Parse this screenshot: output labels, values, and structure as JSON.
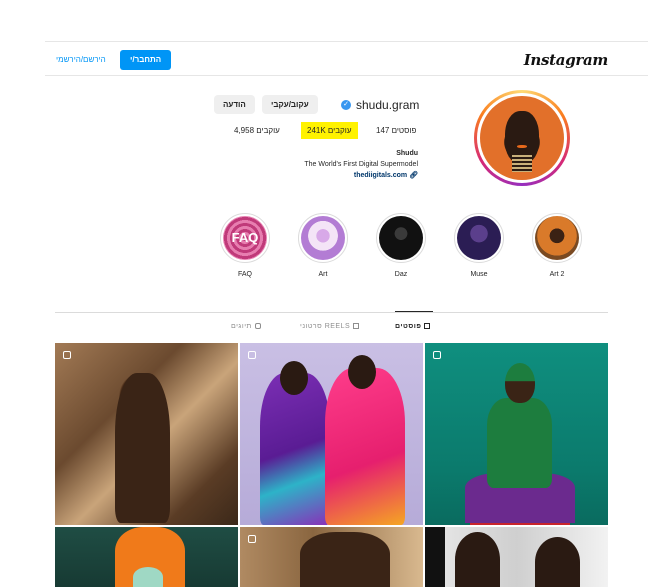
{
  "header": {
    "logo": "Instagram",
    "login_label": "התחבר/י",
    "signup_label": "הירשם/הירשמי"
  },
  "profile": {
    "username": "shudu.gram",
    "verified": true,
    "follow_label": "עקוב/עקבי",
    "message_label": "הודעה",
    "stats": {
      "posts": "147 פוסטים",
      "followers": "241K עוקבים",
      "following": "4,958 עוקבים"
    },
    "name": "Shudu",
    "bio": "The World's First Digital Supermodel",
    "link": "thediigitals.com"
  },
  "highlights": [
    {
      "label": "FAQ",
      "cover_text": "FAQ"
    },
    {
      "label": "Art"
    },
    {
      "label": "Daz"
    },
    {
      "label": "Muse"
    },
    {
      "label": "Art 2"
    }
  ],
  "tabs": [
    {
      "label": "פוסטים",
      "icon": "grid-icon",
      "active": true
    },
    {
      "label": "סרטוני REELS",
      "icon": "reels-icon",
      "active": false
    },
    {
      "label": "תיוגים",
      "icon": "tag-icon",
      "active": false
    }
  ],
  "colors": {
    "accent": "#0095f6",
    "verified": "#3897f0",
    "highlight_marker": "#fff200"
  }
}
